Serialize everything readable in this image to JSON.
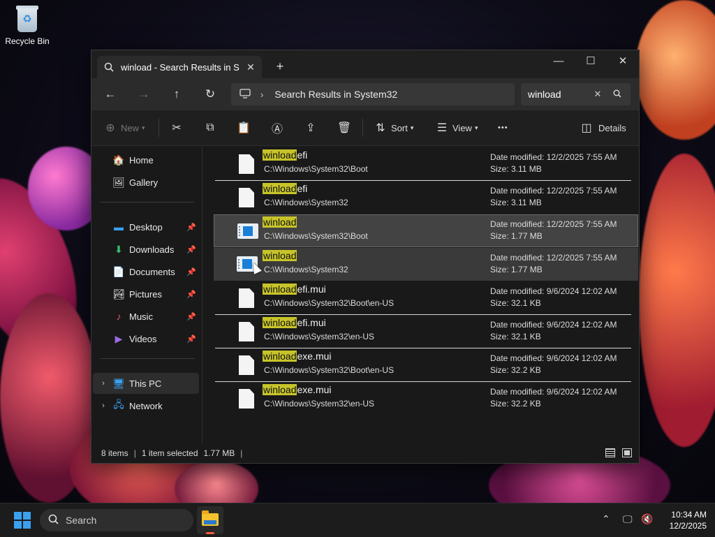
{
  "desktop": {
    "recycle_bin_label": "Recycle Bin"
  },
  "window": {
    "tab_title": "winload - Search Results in Sy",
    "new_tab": "+",
    "controls": {
      "minimize": "—",
      "maximize": "☐",
      "close": "✕"
    },
    "address": {
      "separator": "›",
      "crumb": "Search Results in System32"
    },
    "search": {
      "value": "winload",
      "clear": "✕",
      "icon": "⌕"
    },
    "toolbar": {
      "new_label": "New",
      "sort_label": "Sort",
      "view_label": "View",
      "more_label": "•••",
      "details_label": "Details"
    },
    "sidebar": {
      "home": "Home",
      "gallery": "Gallery",
      "desktop": "Desktop",
      "downloads": "Downloads",
      "documents": "Documents",
      "pictures": "Pictures",
      "music": "Music",
      "videos": "Videos",
      "this_pc": "This PC",
      "network": "Network"
    },
    "results": [
      {
        "hl": "winload",
        "rest": "efi",
        "path": "C:\\Windows\\System32\\Boot",
        "date": "Date modified: 12/2/2025 7:55 AM",
        "size": "Size: 3.11 MB",
        "icon": "document-icon"
      },
      {
        "hl": "winload",
        "rest": "efi",
        "path": "C:\\Windows\\System32",
        "date": "Date modified: 12/2/2025 7:55 AM",
        "size": "Size: 3.11 MB",
        "icon": "document-icon"
      },
      {
        "hl": "winload",
        "rest": "",
        "path": "C:\\Windows\\System32\\Boot",
        "date": "Date modified: 12/2/2025 7:55 AM",
        "size": "Size: 1.77 MB",
        "icon": "application-icon"
      },
      {
        "hl": "winload",
        "rest": "",
        "path": "C:\\Windows\\System32",
        "date": "Date modified: 12/2/2025 7:55 AM",
        "size": "Size: 1.77 MB",
        "icon": "application-icon"
      },
      {
        "hl": "winload",
        "rest": "efi.mui",
        "path": "C:\\Windows\\System32\\Boot\\en-US",
        "date": "Date modified: 9/6/2024 12:02 AM",
        "size": "Size: 32.1 KB",
        "icon": "document-icon"
      },
      {
        "hl": "winload",
        "rest": "efi.mui",
        "path": "C:\\Windows\\System32\\en-US",
        "date": "Date modified: 9/6/2024 12:02 AM",
        "size": "Size: 32.1 KB",
        "icon": "document-icon"
      },
      {
        "hl": "winload",
        "rest": "exe.mui",
        "path": "C:\\Windows\\System32\\Boot\\en-US",
        "date": "Date modified: 9/6/2024 12:02 AM",
        "size": "Size: 32.2 KB",
        "icon": "document-icon"
      },
      {
        "hl": "winload",
        "rest": "exe.mui",
        "path": "C:\\Windows\\System32\\en-US",
        "date": "Date modified: 9/6/2024 12:02 AM",
        "size": "Size: 32.2 KB",
        "icon": "document-icon"
      }
    ],
    "status": {
      "items": "8 items",
      "selected": "1 item selected",
      "size": "1.77 MB",
      "sep": "|"
    }
  },
  "taskbar": {
    "search_label": "Search",
    "time": "10:34 AM",
    "date": "12/2/2025"
  },
  "colors": {
    "highlight": "#c7c42a",
    "accent": "#3aa0f0"
  }
}
